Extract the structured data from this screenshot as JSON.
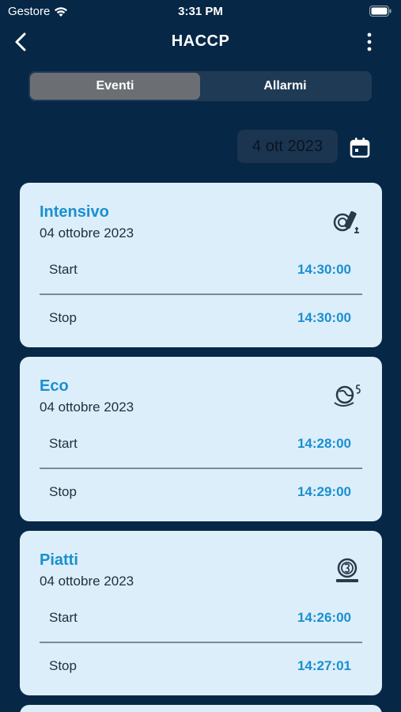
{
  "status_bar": {
    "carrier": "Gestore",
    "time": "3:31 PM"
  },
  "header": {
    "title": "HACCP"
  },
  "tabs": [
    {
      "label": "Eventi",
      "active": true
    },
    {
      "label": "Allarmi",
      "active": false
    }
  ],
  "date_filter": {
    "value": "4 ott 2023"
  },
  "events": [
    {
      "name": "Intensivo",
      "date": "04 ottobre 2023",
      "icon": "intensive-cycle-icon",
      "start_label": "Start",
      "start": "14:30:00",
      "stop_label": "Stop",
      "stop": "14:30:00"
    },
    {
      "name": "Eco",
      "date": "04 ottobre 2023",
      "icon": "eco-cycle-icon",
      "start_label": "Start",
      "start": "14:28:00",
      "stop_label": "Stop",
      "stop": "14:29:00"
    },
    {
      "name": "Piatti",
      "date": "04 ottobre 2023",
      "icon": "plates-cycle-icon",
      "start_label": "Start",
      "start": "14:26:00",
      "stop_label": "Stop",
      "stop": "14:27:01"
    }
  ],
  "colors": {
    "background": "#062746",
    "card": "#dceef9",
    "accent": "#1a8fd1",
    "active_tab": "#6b6f74"
  }
}
